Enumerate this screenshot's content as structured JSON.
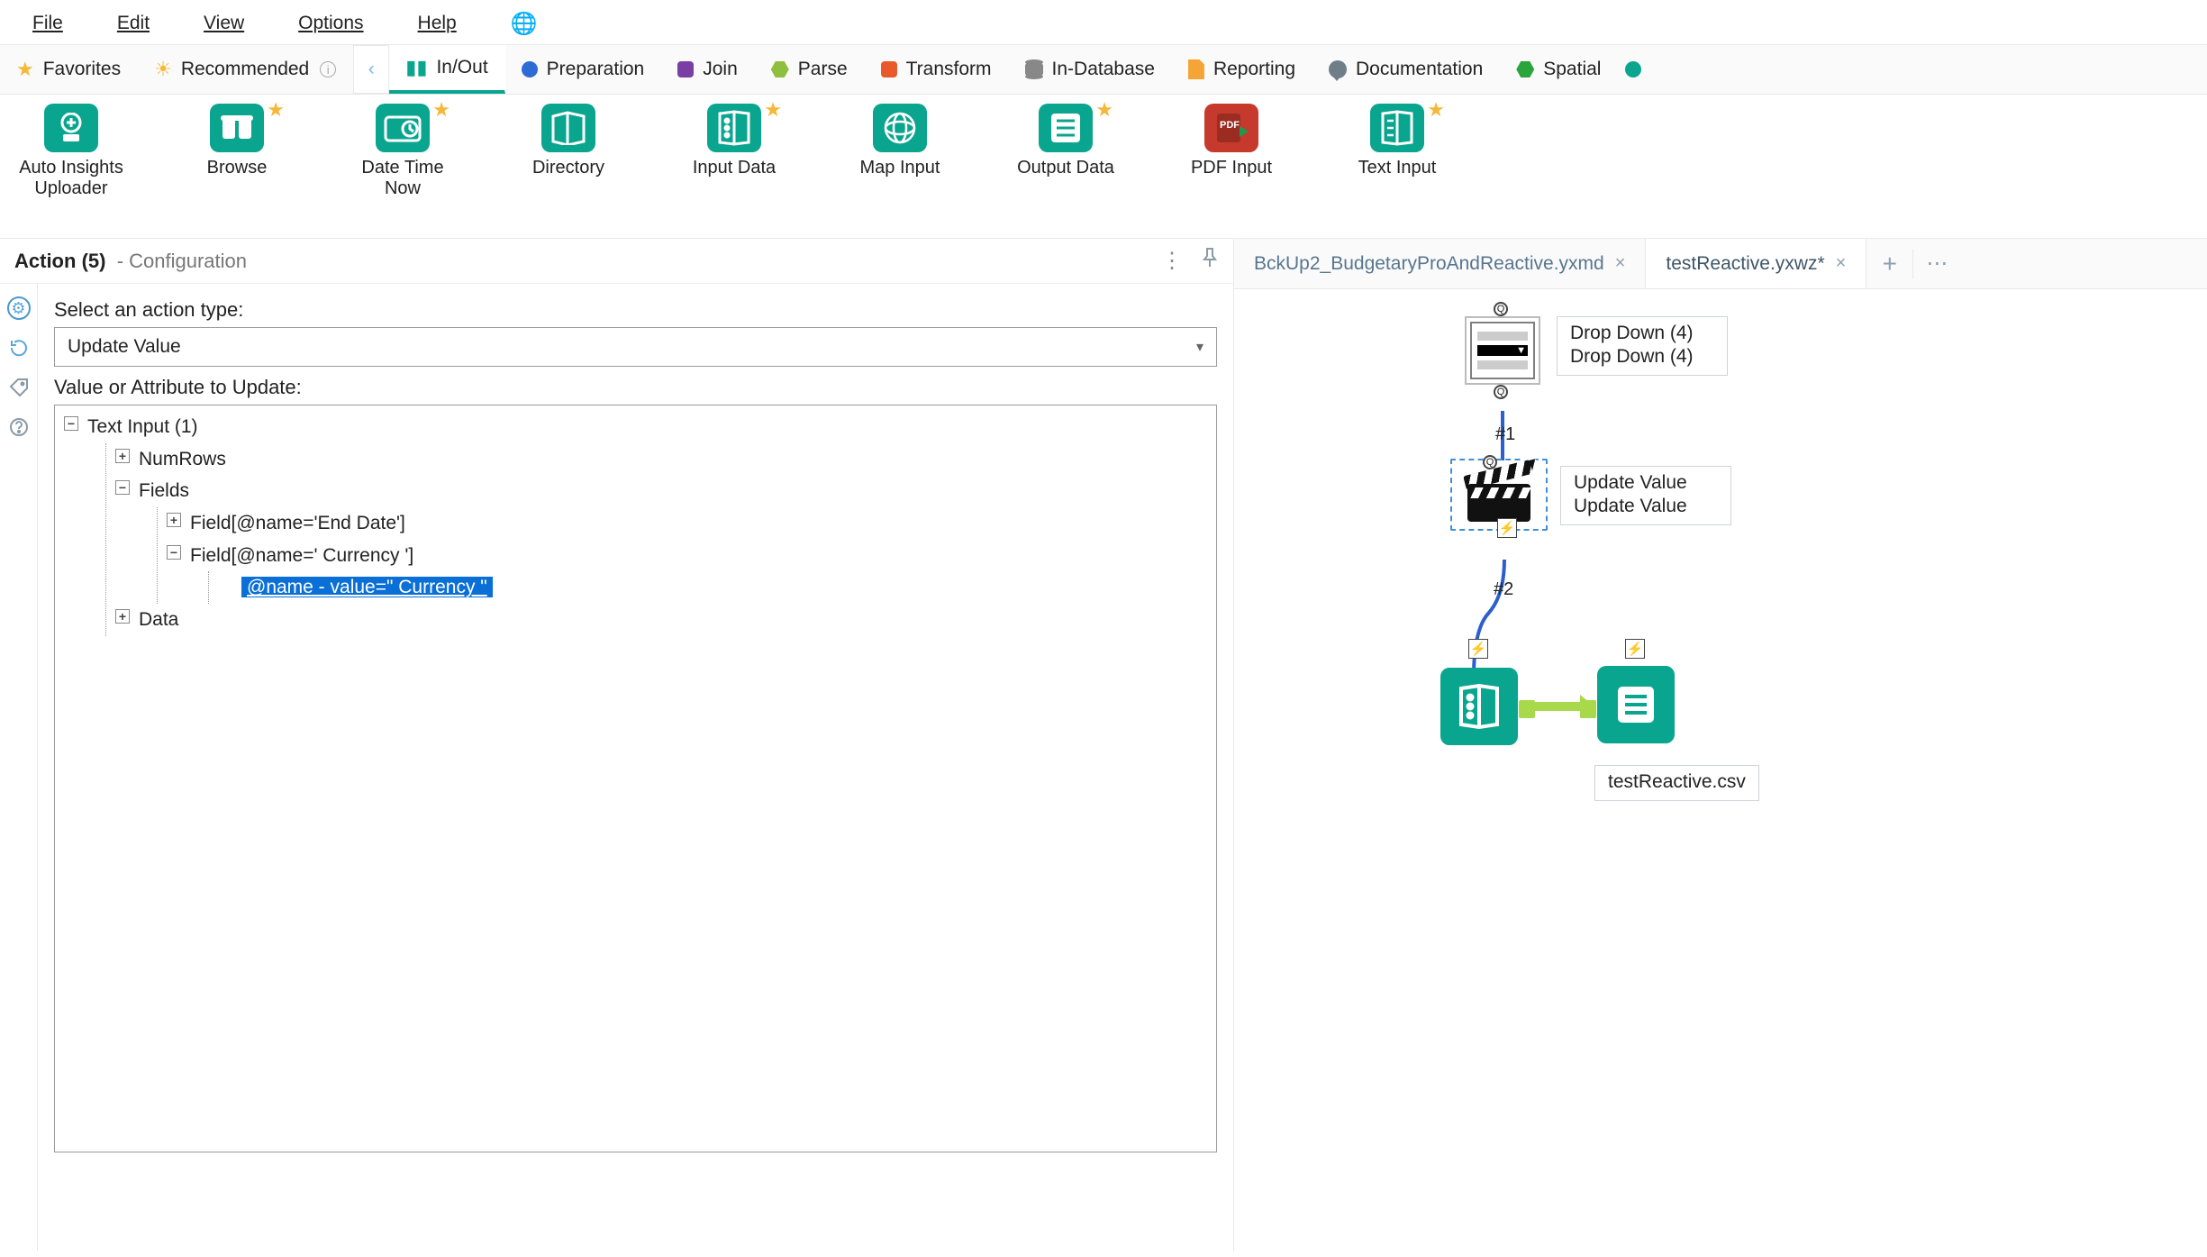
{
  "menu": {
    "file": "File",
    "edit": "Edit",
    "view": "View",
    "options": "Options",
    "help": "Help"
  },
  "categories": {
    "favorites": "Favorites",
    "recommended": "Recommended",
    "inout": "In/Out",
    "preparation": "Preparation",
    "join": "Join",
    "parse": "Parse",
    "transform": "Transform",
    "indb": "In-Database",
    "reporting": "Reporting",
    "documentation": "Documentation",
    "spatial": "Spatial"
  },
  "tools": {
    "autoinsights": "Auto Insights Uploader",
    "browse": "Browse",
    "datetimenow": "Date Time Now",
    "directory": "Directory",
    "inputdata": "Input Data",
    "mapinput": "Map Input",
    "outputdata": "Output Data",
    "pdfinput": "PDF Input",
    "textinput": "Text Input"
  },
  "config": {
    "header_tool": "Action",
    "header_id": "(5)",
    "header_suffix": "- Configuration",
    "label_action_type": "Select an action type:",
    "action_value": "Update Value",
    "label_value_attr": "Value or Attribute to Update:",
    "tree": {
      "root": "Text Input (1)",
      "numrows": "NumRows",
      "fields": "Fields",
      "field_end": "Field[@name='End Date']",
      "field_cur": "Field[@name='  Currency   ']",
      "attr_cur": "@name - value=\"  Currency   \"",
      "data": "Data"
    }
  },
  "tabs": {
    "t1": "BckUp2_BudgetaryProAndReactive.yxmd",
    "t2": "testReactive.yxwz*"
  },
  "canvas": {
    "dd_label1": "Drop Down (4)",
    "dd_label2": "Drop Down (4)",
    "uv_label1": "Update Value",
    "uv_label2": "Update Value",
    "wire1": "#1",
    "wire2": "#2",
    "outlabel": "testReactive.csv"
  }
}
